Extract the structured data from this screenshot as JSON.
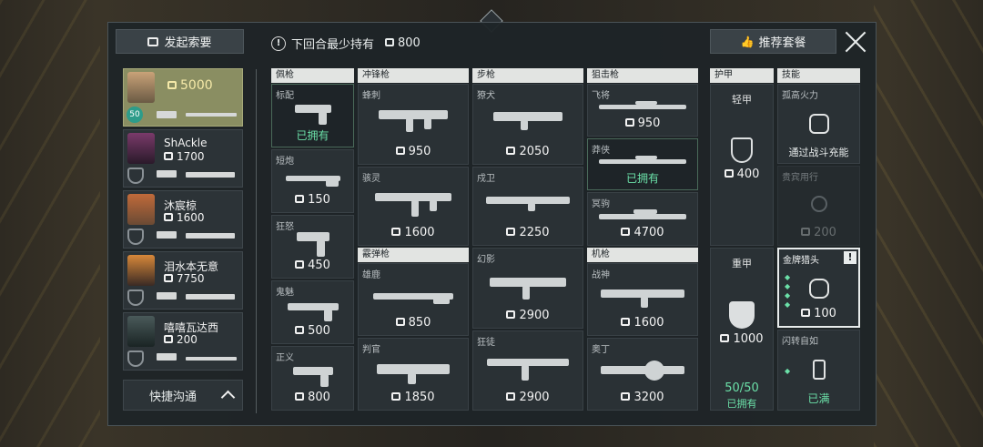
{
  "header": {
    "request_label": "发起索要",
    "min_hold_label": "下回合最少持有",
    "min_hold_value": "800",
    "recommend_label": "推荐套餐"
  },
  "players": [
    {
      "name": "",
      "money": "5000",
      "level": "50",
      "selected": true
    },
    {
      "name": "ShAckle",
      "money": "1700"
    },
    {
      "name": "沐宸椋",
      "money": "1600"
    },
    {
      "name": "泪水本无意",
      "money": "7750"
    },
    {
      "name": "嘻嘻瓦达西",
      "money": "200"
    }
  ],
  "quick_comm_label": "快捷沟通",
  "categories": {
    "sidearm": "佩枪",
    "smg": "冲锋枪",
    "rifle": "步枪",
    "sniper": "狙击枪",
    "shotgun": "霰弹枪",
    "mg": "机枪",
    "armor": "护甲",
    "skills": "技能"
  },
  "weapons": {
    "classic": {
      "name": "标配",
      "status": "已拥有"
    },
    "shorty": {
      "name": "短炮",
      "price": "150"
    },
    "frenzy": {
      "name": "狂怒",
      "price": "450"
    },
    "ghost": {
      "name": "鬼魅",
      "price": "500"
    },
    "sheriff": {
      "name": "正义",
      "price": "800"
    },
    "stinger": {
      "name": "蜂刺",
      "price": "950"
    },
    "spectre": {
      "name": "骇灵",
      "price": "1600"
    },
    "bucky": {
      "name": "雄鹿",
      "price": "850"
    },
    "judge": {
      "name": "判官",
      "price": "1850"
    },
    "bulldog": {
      "name": "獠犬",
      "price": "2050"
    },
    "guardian": {
      "name": "戍卫",
      "price": "2250"
    },
    "phantom": {
      "name": "幻影",
      "price": "2900"
    },
    "vandal": {
      "name": "狂徒",
      "price": "2900"
    },
    "marshal": {
      "name": "飞将",
      "price": "950"
    },
    "outlaw": {
      "name": "莽侠",
      "status": "已拥有"
    },
    "operator": {
      "name": "冥驹",
      "price": "4700"
    },
    "ares": {
      "name": "战神",
      "price": "1600"
    },
    "odin": {
      "name": "奥丁",
      "price": "3200"
    }
  },
  "armor": {
    "light": {
      "name": "轻甲",
      "price": "400"
    },
    "heavy": {
      "name": "重甲",
      "price": "1000",
      "count": "50/50",
      "status": "已拥有"
    }
  },
  "skills": {
    "s1": {
      "name": "孤高火力",
      "status": "通过战斗充能"
    },
    "s2": {
      "name": "贵宾用行",
      "price": "200"
    },
    "s3": {
      "name": "金牌猎头",
      "price": "100"
    },
    "s4": {
      "name": "闪转自如",
      "status": "已满"
    }
  },
  "colors": {
    "owned": "#6be0a8",
    "gold": "#f5e9a8",
    "selected_card": "#8a8e62"
  }
}
